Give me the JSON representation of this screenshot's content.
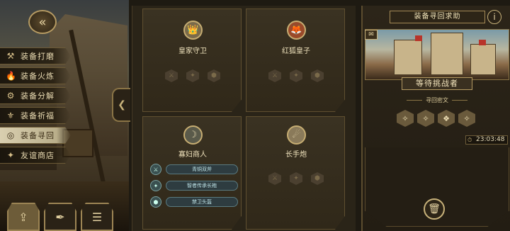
{
  "nav": {
    "back_icon": "back-arrow-icon",
    "menu": [
      {
        "label": "装备打磨",
        "icon": "⚒"
      },
      {
        "label": "装备火炼",
        "icon": "🔥"
      },
      {
        "label": "装备分解",
        "icon": "⚙"
      },
      {
        "label": "装备祈福",
        "icon": "⚜"
      },
      {
        "label": "装备寻回",
        "icon": "◎",
        "active": true
      },
      {
        "label": "友谊商店",
        "icon": "✦"
      }
    ],
    "bottom_buttons": [
      "⇪",
      "✒",
      "☰"
    ]
  },
  "cards": [
    {
      "name": "皇家守卫",
      "portrait": "👑",
      "slots": [
        "⚔",
        "✦",
        "⬢"
      ]
    },
    {
      "name": "红狐皇子",
      "portrait": "🦊",
      "slots": [
        "⚔",
        "✦",
        "⬢"
      ]
    },
    {
      "name": "寡妇商人",
      "portrait": "☽",
      "items": [
        {
          "icon": "⚔",
          "name": "青铜双斧"
        },
        {
          "icon": "✦",
          "name": "智者传承长袍"
        },
        {
          "icon": "⬢",
          "name": "禁卫头盔"
        }
      ]
    },
    {
      "name": "长手炮",
      "portrait": "☄",
      "slots": [
        "⚔",
        "✦",
        "⬢"
      ]
    }
  ],
  "recovery": {
    "title": "装备寻回求助",
    "info": "i",
    "banner": "等待挑战者",
    "subtitle": "寻回密文",
    "runes": [
      "✧",
      "✧",
      "❖",
      "✧"
    ],
    "timer": "23:03:48",
    "timer_icon": "⏱",
    "bag_icon": "✉",
    "trash_icon": "🗑"
  }
}
